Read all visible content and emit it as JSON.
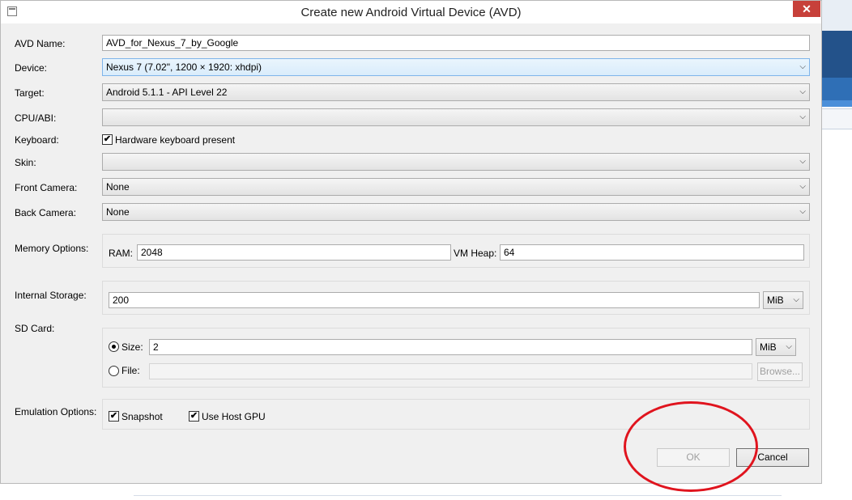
{
  "window": {
    "title": "Create new Android Virtual Device (AVD)",
    "close_glyph": "✕"
  },
  "form": {
    "avd_name": {
      "label": "AVD Name:",
      "value": "AVD_for_Nexus_7_by_Google"
    },
    "device": {
      "label": "Device:",
      "value": "Nexus 7 (7.02\", 1200 × 1920: xhdpi)"
    },
    "target": {
      "label": "Target:",
      "value": "Android 5.1.1 - API Level 22"
    },
    "cpu_abi": {
      "label": "CPU/ABI:",
      "value": ""
    },
    "keyboard": {
      "label": "Keyboard:",
      "checkbox_label": "Hardware keyboard present",
      "checked": true
    },
    "skin": {
      "label": "Skin:",
      "value": ""
    },
    "front_camera": {
      "label": "Front Camera:",
      "value": "None"
    },
    "back_camera": {
      "label": "Back Camera:",
      "value": "None"
    },
    "memory": {
      "label": "Memory Options:",
      "ram_label": "RAM:",
      "ram_value": "2048",
      "vmheap_label": "VM Heap:",
      "vmheap_value": "64"
    },
    "internal_storage": {
      "label": "Internal Storage:",
      "value": "200",
      "unit": "MiB"
    },
    "sd_card": {
      "label": "SD Card:",
      "size_label": "Size:",
      "size_value": "2",
      "size_unit": "MiB",
      "size_selected": true,
      "file_label": "File:",
      "file_value": "",
      "browse_label": "Browse..."
    },
    "emulation": {
      "label": "Emulation Options:",
      "snapshot_label": "Snapshot",
      "snapshot_checked": true,
      "gpu_label": "Use Host GPU",
      "gpu_checked": true
    }
  },
  "buttons": {
    "ok": "OK",
    "cancel": "Cancel"
  },
  "icons": {
    "dropdown": "chevron-down-icon",
    "check": "✔"
  },
  "colors": {
    "annotation": "#e0141e",
    "close": "#c7403a"
  }
}
